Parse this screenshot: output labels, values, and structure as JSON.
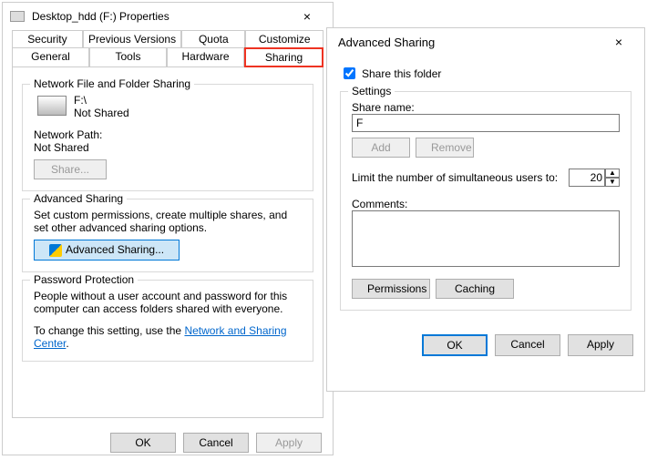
{
  "propWin": {
    "title": "Desktop_hdd (F:) Properties",
    "tabsRow1": [
      "Security",
      "Previous Versions",
      "Quota",
      "Customize"
    ],
    "tabsRow2": [
      "General",
      "Tools",
      "Hardware",
      "Sharing"
    ],
    "activeTab": "Sharing",
    "netShare": {
      "title": "Network File and Folder Sharing",
      "path": "F:\\",
      "status": "Not Shared",
      "netPathLabel": "Network Path:",
      "netPath": "Not Shared",
      "shareBtn": "Share..."
    },
    "advShare": {
      "title": "Advanced Sharing",
      "desc": "Set custom permissions, create multiple shares, and set other advanced sharing options.",
      "btn": "Advanced Sharing..."
    },
    "pwProtect": {
      "title": "Password Protection",
      "desc": "People without a user account and password for this computer can access folders shared with everyone.",
      "linkPre": "To change this setting, use the ",
      "link": "Network and Sharing Center",
      "linkPost": "."
    },
    "btns": {
      "ok": "OK",
      "cancel": "Cancel",
      "apply": "Apply"
    }
  },
  "advWin": {
    "title": "Advanced Sharing",
    "shareCb": "Share this folder",
    "settings": {
      "title": "Settings",
      "shareNameLabel": "Share name:",
      "shareName": "F",
      "add": "Add",
      "remove": "Remove",
      "limitLabel": "Limit the number of simultaneous users to:",
      "limitValue": "20",
      "commentsLabel": "Comments:",
      "permissions": "Permissions",
      "caching": "Caching"
    },
    "btns": {
      "ok": "OK",
      "cancel": "Cancel",
      "apply": "Apply"
    }
  }
}
